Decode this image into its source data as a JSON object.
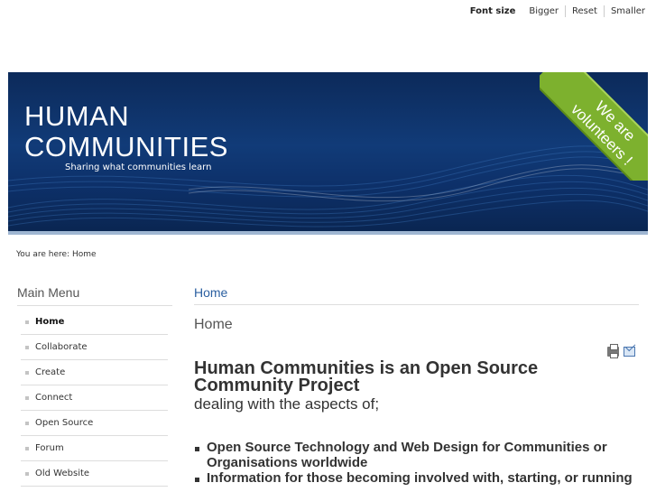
{
  "font_size_bar": {
    "label": "Font size",
    "options": [
      "Bigger",
      "Reset",
      "Smaller"
    ]
  },
  "header": {
    "title_line1": "HUMAN",
    "title_line2": "COMMUNITIES",
    "slogan": "Sharing what communities learn",
    "ribbon_line1": "We are",
    "ribbon_line2": "volunteers !"
  },
  "breadcrumb": "You are here: Home",
  "sidebar": {
    "title": "Main Menu",
    "items": [
      {
        "label": "Home",
        "active": true
      },
      {
        "label": "Collaborate"
      },
      {
        "label": "Create"
      },
      {
        "label": "Connect"
      },
      {
        "label": "Open Source"
      },
      {
        "label": "Forum"
      },
      {
        "label": "Old Website"
      }
    ]
  },
  "main": {
    "section_title": "Home",
    "page_heading": "Home",
    "headline": "Human Communities is an Open Source Community Project",
    "subline": "dealing with the aspects of;",
    "bullets": [
      "Open Source Technology and Web Design for Communities or Organisations worldwide",
      "Information for those becoming involved with, starting, or running"
    ]
  },
  "colors": {
    "banner": "#113b78",
    "accent": "#2b5fa0",
    "ribbon": "#7db12e"
  }
}
